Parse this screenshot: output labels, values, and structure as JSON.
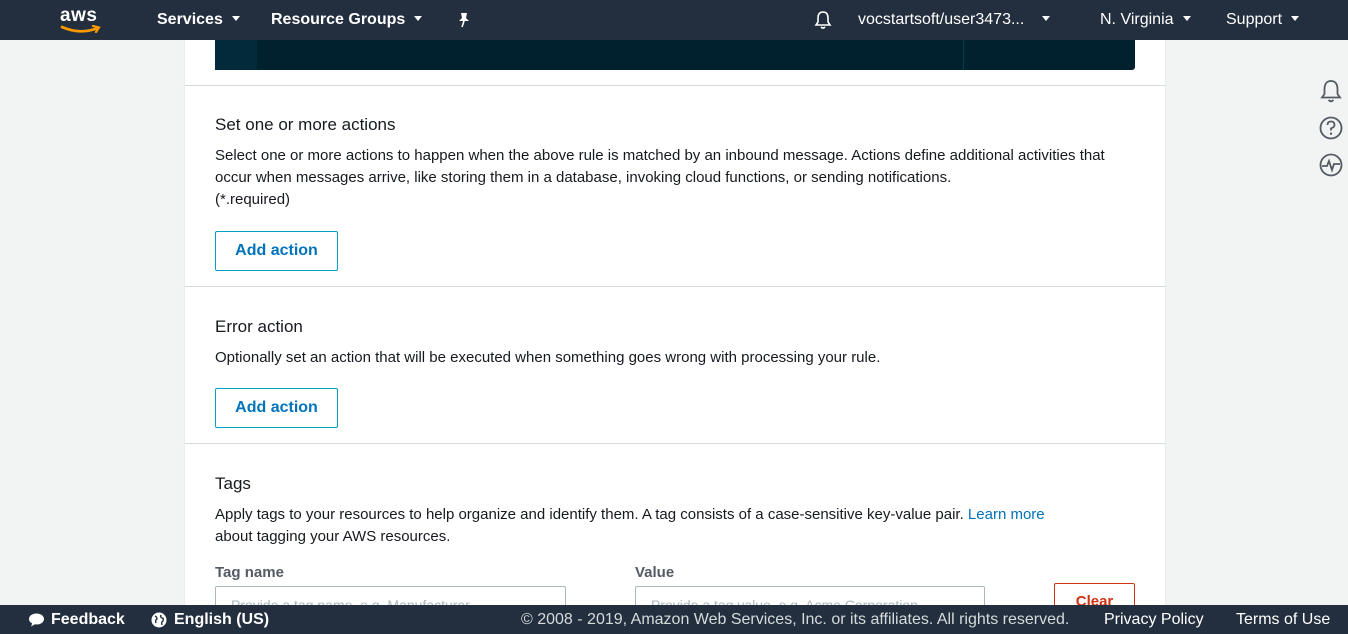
{
  "topnav": {
    "logo_text": "aws",
    "services_label": "Services",
    "resource_groups_label": "Resource Groups",
    "account_label": "vocstartsoft/user3473...",
    "region_label": "N. Virginia",
    "support_label": "Support",
    "icons": [
      "pin-icon",
      "bell-icon"
    ]
  },
  "side_icons": [
    "notifications-icon",
    "help-icon",
    "health-icon"
  ],
  "actions_section": {
    "title": "Set one or more actions",
    "description": "Select one or more actions to happen when the above rule is matched by an inbound message. Actions define additional activities that occur when messages arrive, like storing them in a database, invoking cloud functions, or sending notifications.",
    "required_note": "(*.required)",
    "button_label": "Add action"
  },
  "error_section": {
    "title": "Error action",
    "description": "Optionally set an action that will be executed when something goes wrong with processing your rule.",
    "button_label": "Add action"
  },
  "tags_section": {
    "title": "Tags",
    "description_before": "Apply tags to your resources to help organize and identify them. A tag consists of a case-sensitive key-value pair. ",
    "learn_more": "Learn more",
    "description_after": "about tagging your AWS resources.",
    "tag_name_label": "Tag name",
    "tag_name_placeholder": "Provide a tag name, e.g. Manufacturer",
    "value_label": "Value",
    "value_placeholder": "Provide a tag value, e.g. Acme Corporation",
    "clear_label": "Clear"
  },
  "footer": {
    "feedback_label": "Feedback",
    "language_label": "English (US)",
    "copyright": "© 2008 - 2019, Amazon Web Services, Inc. or its affiliates. All rights reserved.",
    "privacy_label": "Privacy Policy",
    "terms_label": "Terms of Use"
  },
  "colors": {
    "nav_bg": "#232f3e",
    "link": "#0073bb",
    "button_border": "#00a1c9",
    "danger": "#d13212",
    "logo_smile": "#ff9900"
  }
}
